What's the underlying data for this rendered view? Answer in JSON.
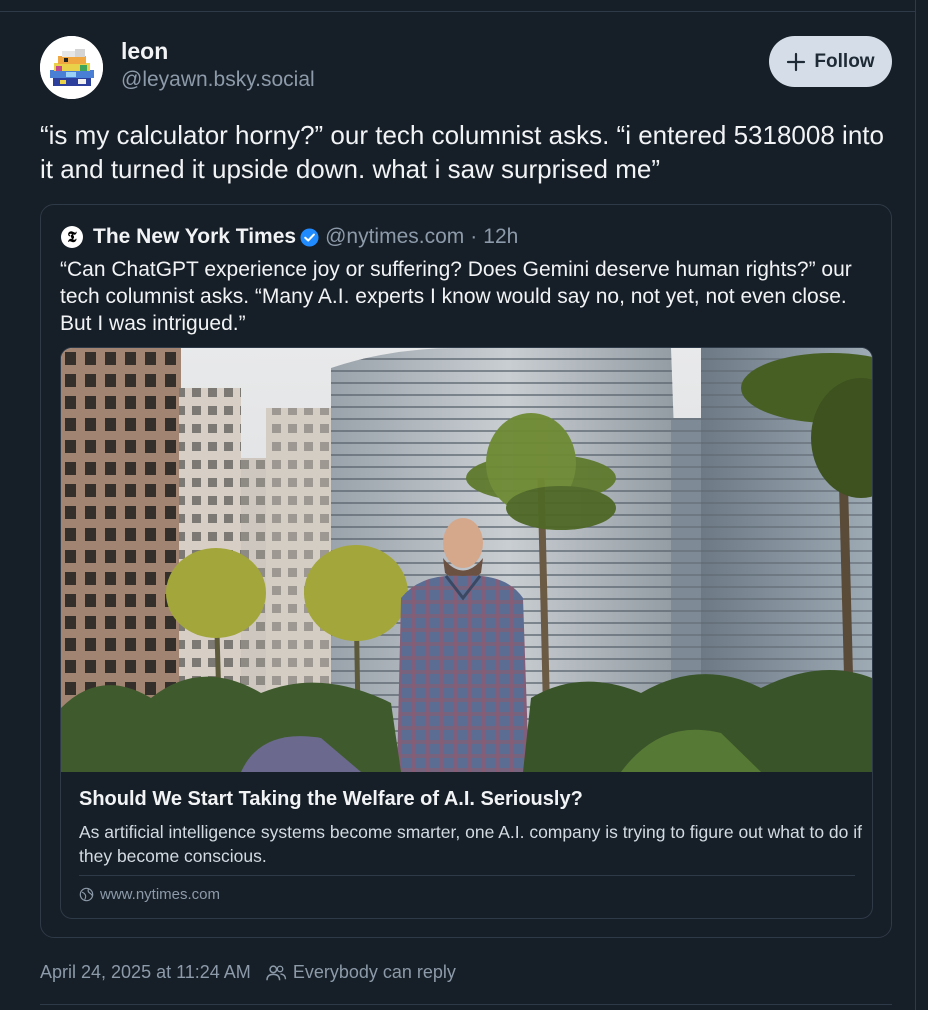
{
  "post": {
    "author": {
      "display_name": "leon",
      "handle": "@leyawn.bsky.social",
      "avatar_icon": "pixel-art-avatar"
    },
    "follow_label": "Follow",
    "text": "“is my calculator horny?” our tech columnist asks. “i entered 5318008 into it and turned it upside down. what i saw surprised me”",
    "timestamp": "April 24, 2025 at 11:24 AM",
    "reply_setting": "Everybody can reply"
  },
  "quote": {
    "logo_glyph": "𝕿",
    "author_name": "The New York Times",
    "verified_icon": "verified-check-icon",
    "handle": "@nytimes.com",
    "separator": "·",
    "time": "12h",
    "text": "“Can ChatGPT experience joy or suffering? Does Gemini deserve human rights?” our tech columnist asks. “Many A.I. experts I know would say no, not yet, not even close. But I was intrigued.”",
    "card": {
      "title": "Should We Start Taking the Welfare of A.I. Seriously?",
      "description": "As artificial intelligence systems become smarter, one A.I. company is trying to figure out what to do if they become conscious.",
      "domain": "www.nytimes.com",
      "domain_icon": "globe-icon"
    }
  },
  "colors": {
    "background": "#161e27",
    "border": "#2e3a47",
    "text_primary": "#f1f3f5",
    "text_secondary": "#8c9aa9",
    "follow_bg": "#d5dee8",
    "verified": "#208bfe"
  }
}
